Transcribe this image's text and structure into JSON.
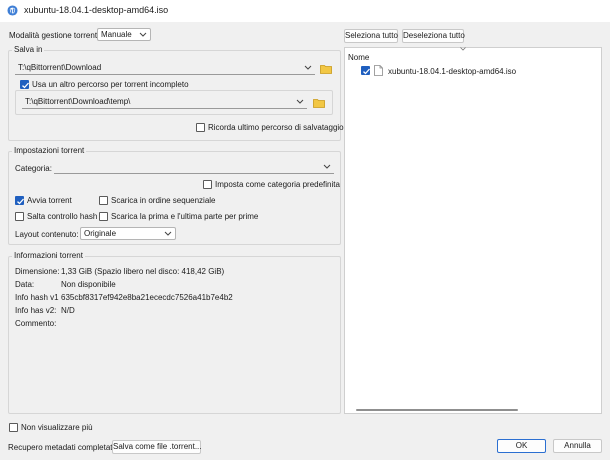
{
  "window": {
    "title": "xubuntu-18.04.1-desktop-amd64.iso",
    "icon": "qbittorrent-logo-icon"
  },
  "management": {
    "label": "Modalità gestione torrent:",
    "value": "Manuale"
  },
  "save_in": {
    "group_title": "Salva in",
    "path": "T:\\qBittorrent\\Download",
    "use_other_path_label": "Usa un altro percorso per torrent incompleto",
    "use_other_path_checked": true,
    "temp_path": "T:\\qBittorrent\\Download\\temp\\",
    "remember_label": "Ricorda ultimo percorso di salvataggio",
    "remember_checked": false
  },
  "torrent_settings": {
    "group_title": "Impostazioni torrent",
    "category_label": "Categoria:",
    "category_value": "",
    "set_default_category_label": "Imposta come categoria predefinita",
    "set_default_category_checked": false,
    "start_torrent_label": "Avvia torrent",
    "start_torrent_checked": true,
    "sequential_label": "Scarica in ordine sequenziale",
    "sequential_checked": false,
    "skip_hash_label": "Salta controllo hash",
    "skip_hash_checked": false,
    "first_last_label": "Scarica la prima e l'ultima parte per prime",
    "first_last_checked": false,
    "layout_label": "Layout contenuto:",
    "layout_value": "Originale"
  },
  "torrent_info": {
    "group_title": "Informazioni torrent",
    "rows": [
      {
        "key": "Dimensione:",
        "value": "1,33 GiB (Spazio libero nel disco: 418,42 GiB)"
      },
      {
        "key": "Data:",
        "value": "Non disponibile"
      },
      {
        "key": "Info hash v1",
        "value": "635cbf8317ef942e8ba21ececdc7526a41b7e4b2"
      },
      {
        "key": "Info has v2:",
        "value": "N/D"
      },
      {
        "key": "Commento:",
        "value": ""
      }
    ]
  },
  "files": {
    "select_all": "Seleziona tutto",
    "deselect_all": "Deseleziona tutto",
    "column_header": "Nome",
    "items": [
      {
        "name": "xubuntu-18.04.1-desktop-amd64.iso",
        "checked": true,
        "icon": "file-icon"
      }
    ]
  },
  "footer": {
    "dont_show_label": "Non visualizzare più",
    "dont_show_checked": false,
    "status": "Recupero metadati completato",
    "save_as_torrent": "Salva come file .torrent...",
    "ok": "OK",
    "cancel": "Annulla"
  },
  "colors": {
    "accent": "#1f5fbf",
    "folder": "#f2c744",
    "window_bg": "#f0f0f0"
  }
}
